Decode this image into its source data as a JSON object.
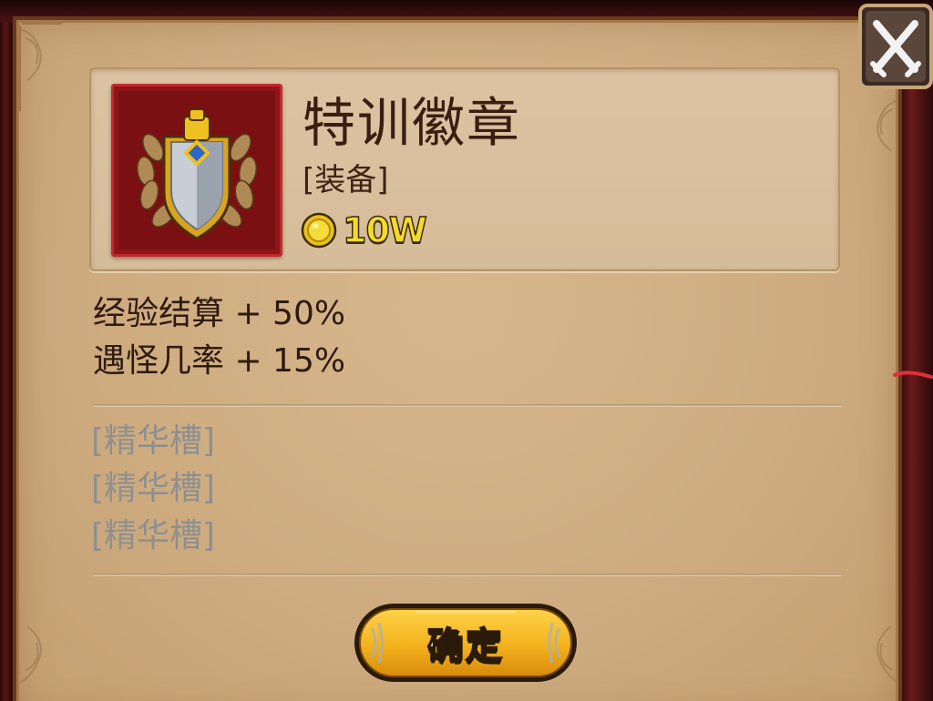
{
  "item": {
    "name": "特训徽章",
    "type_label": "[装备]",
    "price": "10W",
    "icon": "shield-laurel-badge-icon",
    "frame_color": "#c4272c"
  },
  "stats": [
    "经验结算 + 50%",
    "遇怪几率 + 15%"
  ],
  "slots": [
    "[精华槽]",
    "[精华槽]",
    "[精华槽]"
  ],
  "buttons": {
    "confirm_label": "确定",
    "close_icon": "crossed-swords-close-icon"
  },
  "colors": {
    "panel_bg": "#ceac80",
    "price_gold": "#f2dc2a",
    "slot_grey": "#8f8f8f",
    "button_gold": "#f2b21c"
  }
}
